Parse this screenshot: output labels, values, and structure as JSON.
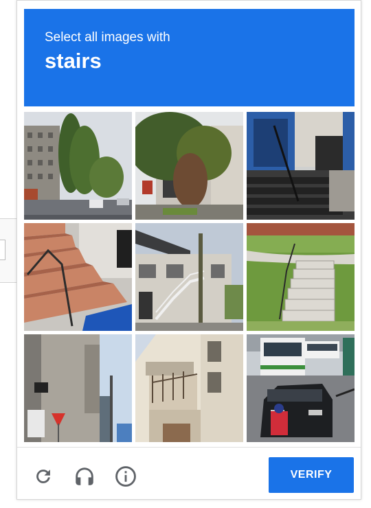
{
  "header": {
    "instruction": "Select all images with",
    "target": "stairs"
  },
  "grid": {
    "rows": 3,
    "columns": 3,
    "tiles": [
      {
        "row": 1,
        "col": 1,
        "subject": "street with apartment building and tall poplar trees"
      },
      {
        "row": 1,
        "col": 2,
        "subject": "house entrance behind large tree"
      },
      {
        "row": 1,
        "col": 3,
        "subject": "dark stairs with railing at building entrance"
      },
      {
        "row": 2,
        "col": 1,
        "subject": "tiled outdoor steps with metal handrail"
      },
      {
        "row": 2,
        "col": 2,
        "subject": "building with external staircase"
      },
      {
        "row": 2,
        "col": 3,
        "subject": "concrete steps on grassy slope"
      },
      {
        "row": 3,
        "col": 1,
        "subject": "narrow street with buildings and stop sign"
      },
      {
        "row": 3,
        "col": 2,
        "subject": "apartment building balcony"
      },
      {
        "row": 3,
        "col": 3,
        "subject": "street with car and bus"
      }
    ]
  },
  "footer": {
    "reload_icon": "reload-icon",
    "audio_icon": "headphones-icon",
    "info_icon": "info-icon",
    "verify_label": "VERIFY"
  },
  "colors": {
    "accent": "#1a73e8",
    "icon_gray": "#5f6368"
  }
}
